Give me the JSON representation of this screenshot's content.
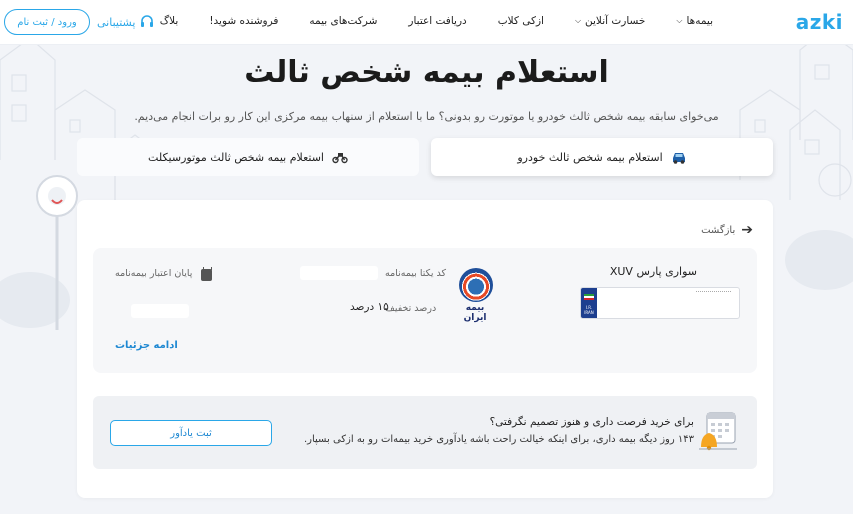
{
  "header": {
    "logo": "azki",
    "nav": [
      {
        "label": "بیمه‌ها",
        "has_dropdown": true
      },
      {
        "label": "خسارت آنلاین",
        "has_dropdown": true
      },
      {
        "label": "ازکی کلاب",
        "has_dropdown": false
      },
      {
        "label": "دریافت اعتبار",
        "has_dropdown": false
      },
      {
        "label": "شرکت‌های بیمه",
        "has_dropdown": false
      },
      {
        "label": "فروشنده شوید!",
        "has_dropdown": false
      },
      {
        "label": "بلاگ",
        "has_dropdown": false
      }
    ],
    "support_label": "پشتیبانی",
    "login_label": "ورود / ثبت نام"
  },
  "hero": {
    "title": "استعلام بیمه شخص ثالث",
    "subtitle": "می‌خوای سابقه بیمه شخص ثالث خودرو یا موتورت رو بدونی؟ ما با استعلام از سنهاب بیمه مرکزی این کار رو برات انجام می‌دیم."
  },
  "tabs": {
    "car": "استعلام بیمه شخص ثالث خودرو",
    "motorcycle": "استعلام بیمه شخص ثالث موتورسیکلت"
  },
  "result": {
    "back_label": "بازگشت",
    "vehicle_name": "سواری پارس XUV",
    "plate_country": "I.R. IRAN",
    "insurer_name": "بیمه ایران",
    "unique_code_label": "کد یکتا بیمه‌نامه",
    "discount_label": "درصد تخفیف",
    "discount_value": "۱۵ درصد",
    "expiry_label": "پایان اعتبار بیمه‌نامه",
    "details_link": "ادامه جزئیات"
  },
  "reminder": {
    "title": "برای خرید فرصت داری و هنوز تصمیم نگرفتی؟",
    "text": "۱۴۳ روز دیگه بیمه داری، برای اینکه خیالت راحت باشه یادآوری خرید بیمه‌ات رو به ازکی بسپار.",
    "button_label": "ثبت یادآور"
  },
  "colors": {
    "accent": "#2aa7e8",
    "link": "#1e88d2",
    "background": "#f2f4f8"
  },
  "icons": {
    "support": "headset-icon",
    "back": "arrow-right-icon",
    "car": "car-icon",
    "motorcycle": "motorcycle-icon",
    "expiry": "calendar-icon",
    "reminder": "calendar-bell-icon"
  }
}
